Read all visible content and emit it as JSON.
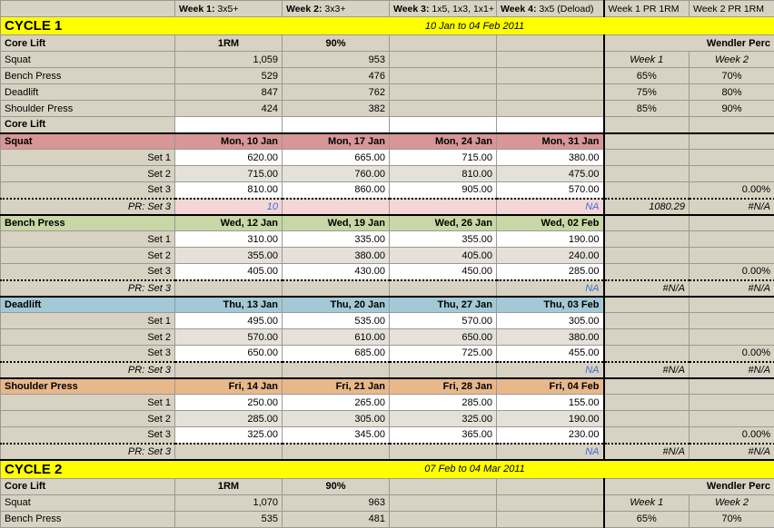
{
  "header": {
    "weeks": [
      {
        "label": "Week 1:",
        "scheme": "3x5+"
      },
      {
        "label": "Week 2:",
        "scheme": "3x3+"
      },
      {
        "label": "Week 3:",
        "scheme": "1x5, 1x3, 1x1+"
      },
      {
        "label": "Week 4:",
        "scheme": "3x5 (Deload)"
      }
    ],
    "pr1": "Week 1 PR 1RM",
    "pr2": "Week 2 PR 1RM"
  },
  "cycle1": {
    "title": "CYCLE 1",
    "dates": "10 Jan to 04 Feb 2011",
    "coreliftHead": {
      "label": "Core Lift",
      "c1": "1RM",
      "c2": "90%",
      "wendler": "Wendler Perc"
    },
    "lifts": [
      {
        "name": "Squat",
        "rm": "1,059",
        "ninety": "953"
      },
      {
        "name": "Bench Press",
        "rm": "529",
        "ninety": "476"
      },
      {
        "name": "Deadlift",
        "rm": "847",
        "ninety": "762"
      },
      {
        "name": "Shoulder Press",
        "rm": "424",
        "ninety": "382"
      }
    ],
    "wendlerHead": {
      "w1": "Week 1",
      "w2": "Week 2"
    },
    "wendlerRows": [
      {
        "w1": "65%",
        "w2": "70%"
      },
      {
        "w1": "75%",
        "w2": "80%"
      },
      {
        "w1": "85%",
        "w2": "90%"
      }
    ],
    "coreLiftLabel": "Core Lift",
    "exercises": [
      {
        "name": "Squat",
        "cls": "bg-squat",
        "dates": [
          "Mon, 10 Jan",
          "Mon, 17 Jan",
          "Mon, 24 Jan",
          "Mon, 31 Jan"
        ],
        "sets": [
          {
            "label": "Set 1",
            "v": [
              "620.00",
              "665.00",
              "715.00",
              "380.00"
            ],
            "bg": "bg-white"
          },
          {
            "label": "Set 2",
            "v": [
              "715.00",
              "760.00",
              "810.00",
              "475.00"
            ],
            "bg": "bg-gray"
          },
          {
            "label": "Set 3",
            "v": [
              "810.00",
              "860.00",
              "905.00",
              "570.00"
            ],
            "bg": "bg-white",
            "pr2": "0.00%"
          }
        ],
        "pr": {
          "label": "PR: Set 3",
          "v1": "10",
          "v4": "NA",
          "p1": "1080.29",
          "p2": "#N/A",
          "pink": true
        }
      },
      {
        "name": "Bench Press",
        "cls": "bg-bench",
        "dates": [
          "Wed, 12 Jan",
          "Wed, 19 Jan",
          "Wed, 26 Jan",
          "Wed, 02 Feb"
        ],
        "sets": [
          {
            "label": "Set 1",
            "v": [
              "310.00",
              "335.00",
              "355.00",
              "190.00"
            ],
            "bg": "bg-white"
          },
          {
            "label": "Set 2",
            "v": [
              "355.00",
              "380.00",
              "405.00",
              "240.00"
            ],
            "bg": "bg-gray"
          },
          {
            "label": "Set 3",
            "v": [
              "405.00",
              "430.00",
              "450.00",
              "285.00"
            ],
            "bg": "bg-white",
            "pr2": "0.00%"
          }
        ],
        "pr": {
          "label": "PR: Set 3",
          "v1": "",
          "v4": "NA",
          "p1": "#N/A",
          "p2": "#N/A"
        }
      },
      {
        "name": "Deadlift",
        "cls": "bg-deadlift",
        "dates": [
          "Thu, 13 Jan",
          "Thu, 20 Jan",
          "Thu, 27 Jan",
          "Thu, 03 Feb"
        ],
        "sets": [
          {
            "label": "Set 1",
            "v": [
              "495.00",
              "535.00",
              "570.00",
              "305.00"
            ],
            "bg": "bg-white"
          },
          {
            "label": "Set 2",
            "v": [
              "570.00",
              "610.00",
              "650.00",
              "380.00"
            ],
            "bg": "bg-gray"
          },
          {
            "label": "Set 3",
            "v": [
              "650.00",
              "685.00",
              "725.00",
              "455.00"
            ],
            "bg": "bg-white",
            "pr2": "0.00%"
          }
        ],
        "pr": {
          "label": "PR: Set 3",
          "v1": "",
          "v4": "NA",
          "p1": "#N/A",
          "p2": "#N/A"
        }
      },
      {
        "name": "Shoulder Press",
        "cls": "bg-shoulder",
        "dates": [
          "Fri, 14 Jan",
          "Fri, 21 Jan",
          "Fri, 28 Jan",
          "Fri, 04 Feb"
        ],
        "sets": [
          {
            "label": "Set 1",
            "v": [
              "250.00",
              "265.00",
              "285.00",
              "155.00"
            ],
            "bg": "bg-white"
          },
          {
            "label": "Set 2",
            "v": [
              "285.00",
              "305.00",
              "325.00",
              "190.00"
            ],
            "bg": "bg-gray"
          },
          {
            "label": "Set 3",
            "v": [
              "325.00",
              "345.00",
              "365.00",
              "230.00"
            ],
            "bg": "bg-white",
            "pr2": "0.00%"
          }
        ],
        "pr": {
          "label": "PR: Set 3",
          "v1": "",
          "v4": "NA",
          "p1": "#N/A",
          "p2": "#N/A"
        }
      }
    ]
  },
  "cycle2": {
    "title": "CYCLE 2",
    "dates": "07 Feb to 04 Mar 2011",
    "coreliftHead": {
      "label": "Core Lift",
      "c1": "1RM",
      "c2": "90%",
      "wendler": "Wendler Perc"
    },
    "lifts": [
      {
        "name": "Squat",
        "rm": "1,070",
        "ninety": "963"
      },
      {
        "name": "Bench Press",
        "rm": "535",
        "ninety": "481"
      }
    ],
    "wendlerHead": {
      "w1": "Week 1",
      "w2": "Week 2"
    },
    "wendlerRows": [
      {
        "w1": "65%",
        "w2": "70%"
      }
    ]
  }
}
